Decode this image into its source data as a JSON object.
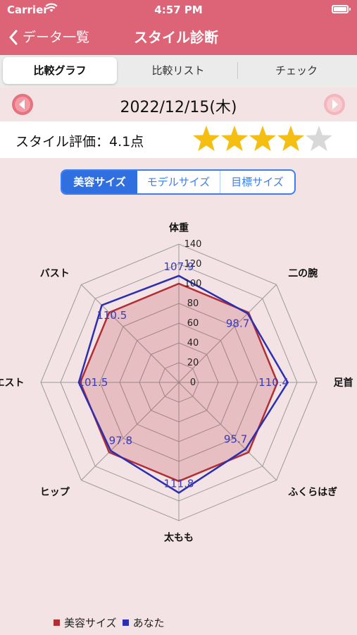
{
  "status_bar": {
    "carrier": "Carrier",
    "time": "4:57 PM"
  },
  "nav": {
    "back_label": "データ一覧",
    "title": "スタイル診断"
  },
  "tabs": [
    {
      "label": "比較グラフ",
      "active": true
    },
    {
      "label": "比較リスト",
      "active": false
    },
    {
      "label": "チェック",
      "active": false
    }
  ],
  "date": "2022/12/15(木)",
  "rating": {
    "label": "スタイル評価：4.1点",
    "stars_filled": 4,
    "stars_total": 5
  },
  "size_segments": [
    {
      "label": "美容サイズ",
      "active": true
    },
    {
      "label": "モデルサイズ",
      "active": false
    },
    {
      "label": "目標サイズ",
      "active": false
    }
  ],
  "colors": {
    "nav": "#dd6476",
    "series_beauty": "#b22e35",
    "series_you": "#2b2fb0",
    "star_on": "#f5be12",
    "star_off": "#d8d8d8",
    "accent": "#2f6fe0"
  },
  "chart_data": {
    "type": "radar",
    "axes": [
      "体重",
      "二の腕",
      "足首",
      "ふくらはぎ",
      "太もも",
      "ヒップ",
      "ウエスト",
      "バスト"
    ],
    "r_ticks": [
      "0",
      "20",
      "40",
      "60",
      "80",
      "100",
      "120",
      "140"
    ],
    "rlim": [
      0,
      140
    ],
    "series": [
      {
        "name": "美容サイズ",
        "values": [
          100,
          100,
          100,
          100,
          100,
          100,
          100,
          100
        ],
        "filled": true
      },
      {
        "name": "あなた",
        "values": [
          107.9,
          98.7,
          110.4,
          95.7,
          111.8,
          97.8,
          101.5,
          110.5
        ],
        "value_labels": [
          "107.9",
          "98.7",
          "110.4",
          "95.7",
          "111.8",
          "97.8",
          "101.5",
          "110.5"
        ]
      }
    ],
    "legend_position": "bottom-left"
  }
}
